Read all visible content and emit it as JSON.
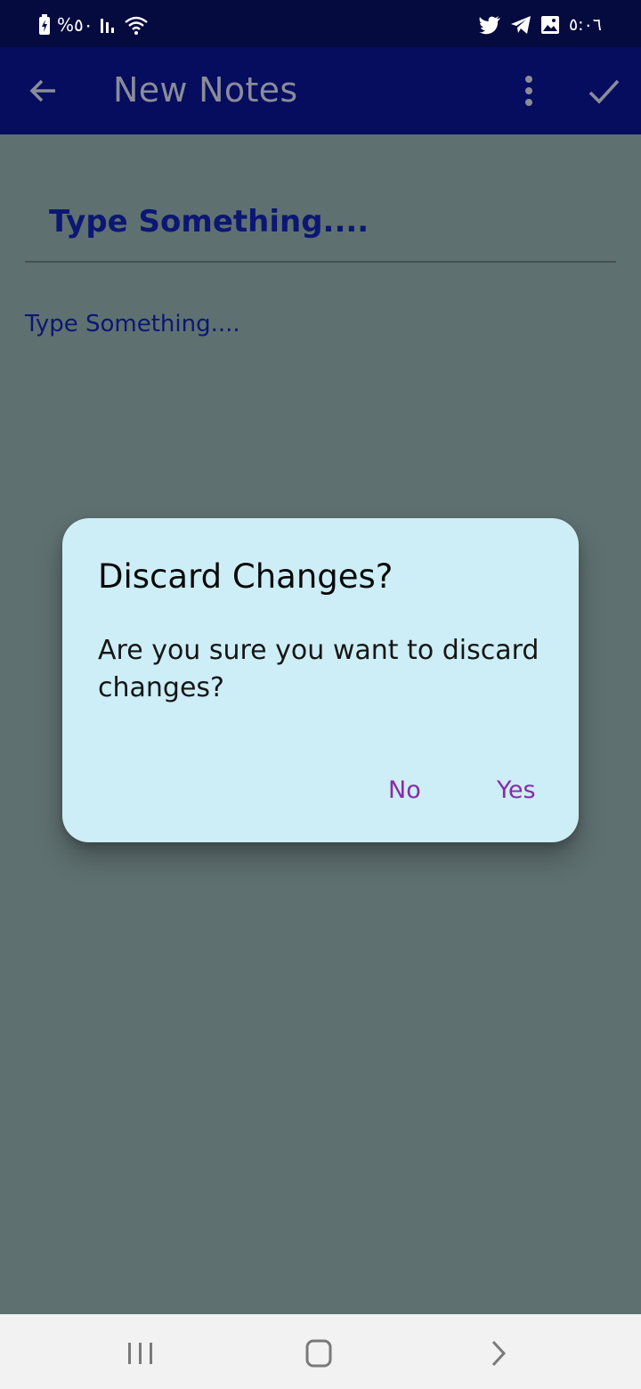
{
  "status_bar": {
    "battery_text": "%٥٠",
    "time": "٥:٠٦",
    "left_icons": [
      "battery-charging-icon",
      "signal-icon",
      "wifi-icon"
    ],
    "right_icons": [
      "twitter-icon",
      "telegram-icon",
      "gallery-icon"
    ]
  },
  "app_bar": {
    "title": "New Notes",
    "back_icon": "arrow-back-icon",
    "more_icon": "more-vert-icon",
    "save_icon": "check-icon"
  },
  "editor": {
    "title_placeholder": "Type Something....",
    "body_placeholder": "Type Something...."
  },
  "dialog": {
    "title": "Discard Changes?",
    "message": "Are you sure you want to discard changes?",
    "no_label": "No",
    "yes_label": "Yes"
  },
  "nav_bar": {
    "icons": [
      "recents-icon",
      "home-icon",
      "back-icon"
    ]
  },
  "colors": {
    "status_bar": "#050a3f",
    "app_bar": "#060d5f",
    "background_dimmed": "#5f7071",
    "dialog_bg": "#cdeef6",
    "dialog_button": "#8a2aa6",
    "input_text": "#0b1773"
  }
}
